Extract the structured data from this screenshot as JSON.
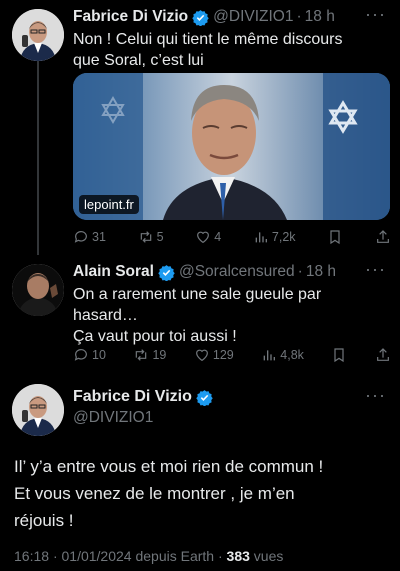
{
  "tweets": [
    {
      "name": "Fabrice Di Vizio",
      "handle": "@DIVIZIO1",
      "time": "18 h",
      "text_lines": [
        "Non ! Celui qui tient le même discours",
        "que Soral, c’est lui"
      ],
      "media_source": "lepoint.fr",
      "replies": "31",
      "retweets": "5",
      "likes": "4",
      "views": "7,2k"
    },
    {
      "name": "Alain Soral",
      "handle": "@Soralcensured",
      "time": "18 h",
      "text_lines": [
        "On a rarement une sale gueule par",
        "hasard…",
        "Ça vaut pour toi aussi !"
      ],
      "replies": "10",
      "retweets": "19",
      "likes": "129",
      "views": "4,8k"
    }
  ],
  "main_tweet": {
    "name": "Fabrice Di Vizio",
    "handle": "@DIVIZIO1",
    "text_lines": [
      "Il’ y’a entre vous et moi rien de commun !",
      "Et vous venez de le montrer , je m’en",
      "réjouis !"
    ],
    "time": "16:18",
    "date": "01/01/2024",
    "source": "depuis Earth",
    "views_count": "383",
    "views_label": "vues"
  },
  "icons": [
    "verified-badge-icon",
    "more-icon",
    "reply-icon",
    "retweet-icon",
    "like-icon",
    "views-icon",
    "bookmark-icon",
    "share-icon"
  ],
  "colors": {
    "background": "#000000",
    "text": "#e7e9ea",
    "muted": "#71767b",
    "verified": "#1d9bf0"
  }
}
